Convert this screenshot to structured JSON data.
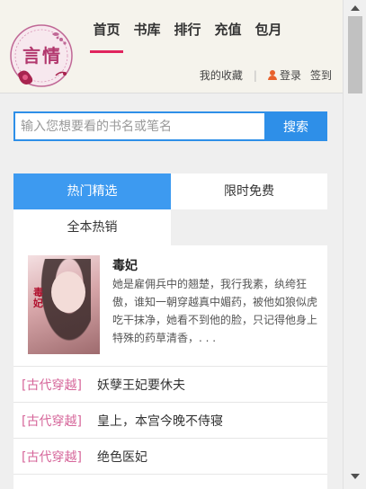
{
  "logo": {
    "text": "言情",
    "icon": "yanqing-logo",
    "accent": "#b2386e"
  },
  "nav": [
    "首页",
    "书库",
    "排行",
    "充值",
    "包月"
  ],
  "userbar": {
    "favorites": "我的收藏",
    "separator": "|",
    "login": "登录",
    "signin": "签到"
  },
  "search": {
    "placeholder": "输入您想要看的书名或笔名",
    "button": "搜索"
  },
  "tabs": [
    "热门精选",
    "限时免费",
    "全本热销"
  ],
  "featured": {
    "title": "毒妃",
    "cover_text": "毒妃",
    "description": "她是雇佣兵中的翘楚，我行我素，纨绔狂傲，谁知一朝穿越真中媚药，被他如狼似虎吃干抹净，她看不到他的脸，只记得他身上特殊的药草清香，. . ."
  },
  "list": [
    {
      "category": "[古代穿越]",
      "title": "妖孽王妃要休夫"
    },
    {
      "category": "[古代穿越]",
      "title": "皇上，本宫今晚不侍寝"
    },
    {
      "category": "[古代穿越]",
      "title": "绝色医妃"
    }
  ],
  "colors": {
    "primary": "#2e8fe8",
    "tab_active": "#3d9af0",
    "nav_underline": "#e0245e",
    "category": "#d6669a",
    "user_icon": "#e8612c"
  }
}
